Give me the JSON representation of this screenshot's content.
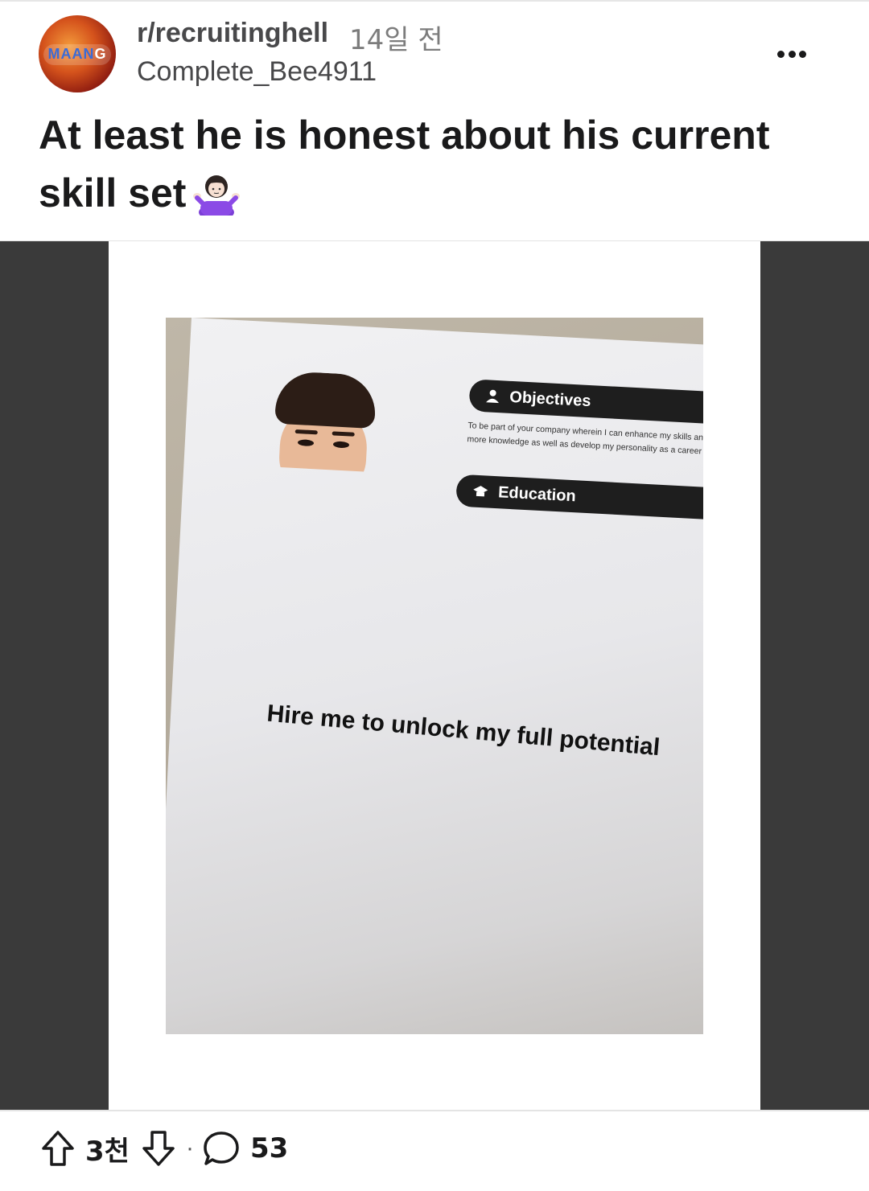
{
  "post": {
    "subreddit": "r/recruitinghell",
    "time_ago": "14일 전",
    "author": "Complete_Bee4911",
    "title": "At least he is honest about his current skill set",
    "title_emoji": "person-shrugging"
  },
  "avatar": {
    "logo_text_a": "MAAN",
    "logo_text_b": "G"
  },
  "resume": {
    "objectives_label": "Objectives",
    "objectives_text": "To be part of your company wherein I can enhance my skills and gain more knowledge as well as develop my personality as a career person.",
    "education_label": "Education",
    "caption": "Hire me to unlock my full potential"
  },
  "footer": {
    "votes": "3천",
    "comments": "53"
  },
  "colors": {
    "background": "#ffffff",
    "media_background": "#3a3a3a",
    "resume_bar": "#1e1e1e",
    "text": "#1a1a1b"
  }
}
